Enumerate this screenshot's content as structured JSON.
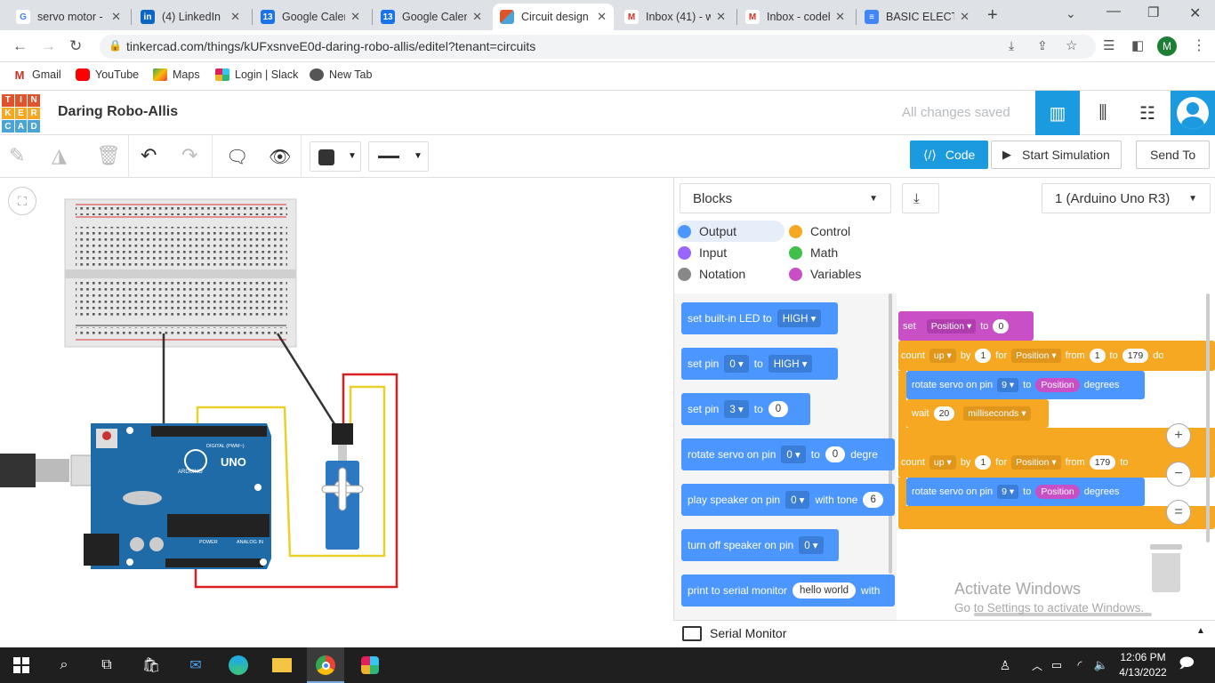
{
  "browser": {
    "tabs": [
      {
        "title": "servo motor -",
        "icon": "google-icon",
        "color": "#4285f4",
        "glyph": "G"
      },
      {
        "title": "(4) LinkedIn",
        "icon": "linkedin-icon",
        "color": "#0a66c2",
        "glyph": "in"
      },
      {
        "title": "Google Calen",
        "icon": "calendar-icon",
        "color": "#1a73e8",
        "glyph": "13"
      },
      {
        "title": "Google Calen",
        "icon": "calendar-icon",
        "color": "#1a73e8",
        "glyph": "13"
      },
      {
        "title": "Circuit design",
        "icon": "tinkercad-icon",
        "color": "#e0542b",
        "glyph": "T"
      },
      {
        "title": "Inbox (41) - w",
        "icon": "gmail-icon",
        "color": "#d93025",
        "glyph": "M"
      },
      {
        "title": "Inbox - codeh",
        "icon": "gmail-icon",
        "color": "#d93025",
        "glyph": "M"
      },
      {
        "title": "BASIC ELECTR",
        "icon": "docs-icon",
        "color": "#4285f4",
        "glyph": "≡"
      }
    ],
    "url": "tinkercad.com/things/kUFxsnveE0d-daring-robo-allis/editel?tenant=circuits",
    "bookmarks": [
      "Gmail",
      "YouTube",
      "Maps",
      "Login | Slack",
      "New Tab"
    ],
    "profile_initial": "M"
  },
  "app": {
    "logo_letters": [
      "T",
      "I",
      "N",
      "K",
      "E",
      "R",
      "C",
      "A",
      "D"
    ],
    "project_title": "Daring Robo-Allis",
    "save_status": "All changes saved",
    "code_button": "Code",
    "start_sim_button": "Start Simulation",
    "send_to_button": "Send To"
  },
  "code_panel": {
    "mode": "Blocks",
    "device": "1 (Arduino Uno R3)",
    "categories": [
      {
        "label": "Output",
        "color": "#4c97ff"
      },
      {
        "label": "Control",
        "color": "#f7a823"
      },
      {
        "label": "Input",
        "color": "#9966ff"
      },
      {
        "label": "Math",
        "color": "#40bf4a"
      },
      {
        "label": "Notation",
        "color": "#888888"
      },
      {
        "label": "Variables",
        "color": "#c94fc6"
      }
    ],
    "palette": [
      {
        "text": "set built-in LED to",
        "dd": "HIGH"
      },
      {
        "text": "set pin",
        "dd1": "0",
        "mid": "to",
        "dd": "HIGH"
      },
      {
        "text": "set pin",
        "dd1": "3",
        "mid": "to",
        "val": "0"
      },
      {
        "text": "rotate servo on pin",
        "dd1": "0",
        "mid": "to",
        "val": "0",
        "tail": "degre"
      },
      {
        "text": "play speaker on pin",
        "dd1": "0",
        "mid": "with tone",
        "val": "6"
      },
      {
        "text": "turn off speaker on pin",
        "dd1": "0"
      },
      {
        "text": "print to serial monitor",
        "val": "hello world",
        "tail": "with"
      }
    ],
    "workspace": {
      "set_block": {
        "set": "set",
        "var": "Position",
        "to": "to",
        "val": "0"
      },
      "loop1": {
        "count": "count",
        "dir": "up",
        "by": "by",
        "byval": "1",
        "for": "for",
        "var": "Position",
        "from": "from",
        "fromval": "1",
        "to": "to",
        "toval": "179",
        "do": "do"
      },
      "servo1": {
        "text": "rotate servo on pin",
        "pin": "9",
        "to": "to",
        "var": "Position",
        "unit": "degrees"
      },
      "wait": {
        "text": "wait",
        "val": "20",
        "unit": "milliseconds"
      },
      "loop2": {
        "count": "count",
        "dir": "up",
        "by": "by",
        "byval": "1",
        "for": "for",
        "var": "Position",
        "from": "from",
        "fromval": "179",
        "to": "to"
      },
      "servo2": {
        "text": "rotate servo on pin",
        "pin": "9",
        "to": "to",
        "var": "Position",
        "unit": "degrees"
      }
    },
    "watermark_title": "Activate Windows",
    "watermark_sub": "Go to Settings to activate Windows.",
    "serial_monitor": "Serial Monitor"
  },
  "circuit": {
    "board_logo": "UNO",
    "board_brand": "ARDUINO",
    "digital_label": "DIGITAL (PWM~)",
    "power_label": "POWER",
    "analog_label": "ANALOG IN"
  },
  "taskbar": {
    "time": "12:06 PM",
    "date": "4/13/2022"
  }
}
